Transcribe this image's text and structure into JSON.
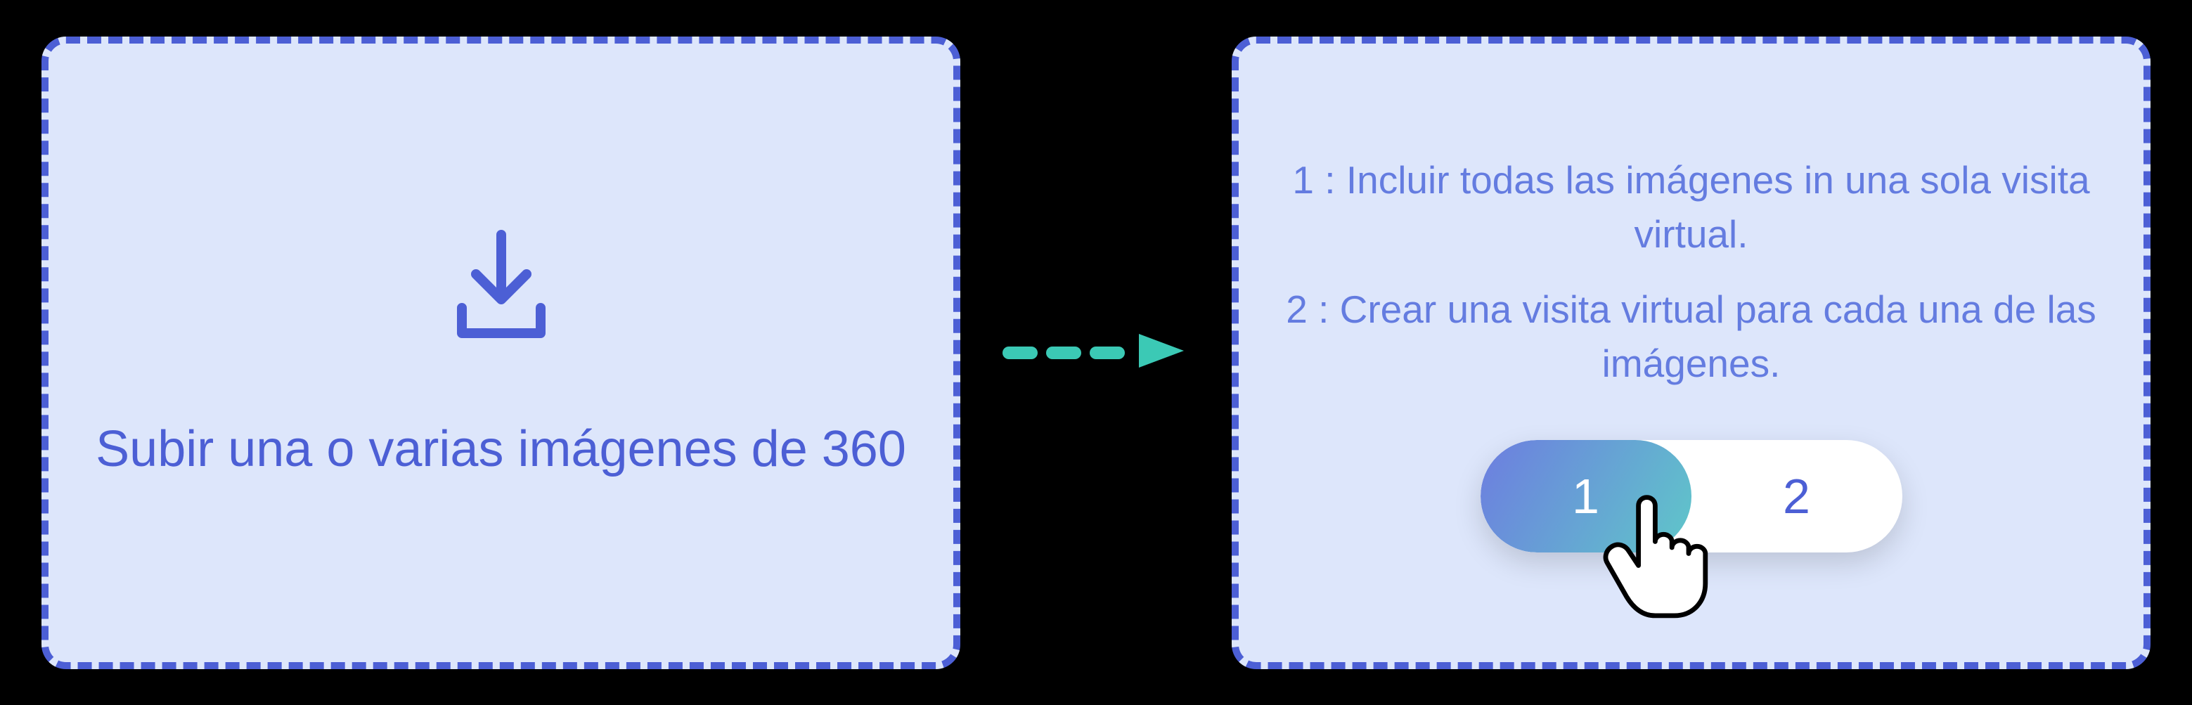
{
  "upload": {
    "text": "Subir una o varias imágenes de 360"
  },
  "options": {
    "option1": "1 : Incluir todas las imágenes in una sola visita virtual.",
    "option2": "2 : Crear una visita virtual para cada una de las imágenes.",
    "toggle": {
      "label1": "1",
      "label2": "2"
    }
  }
}
